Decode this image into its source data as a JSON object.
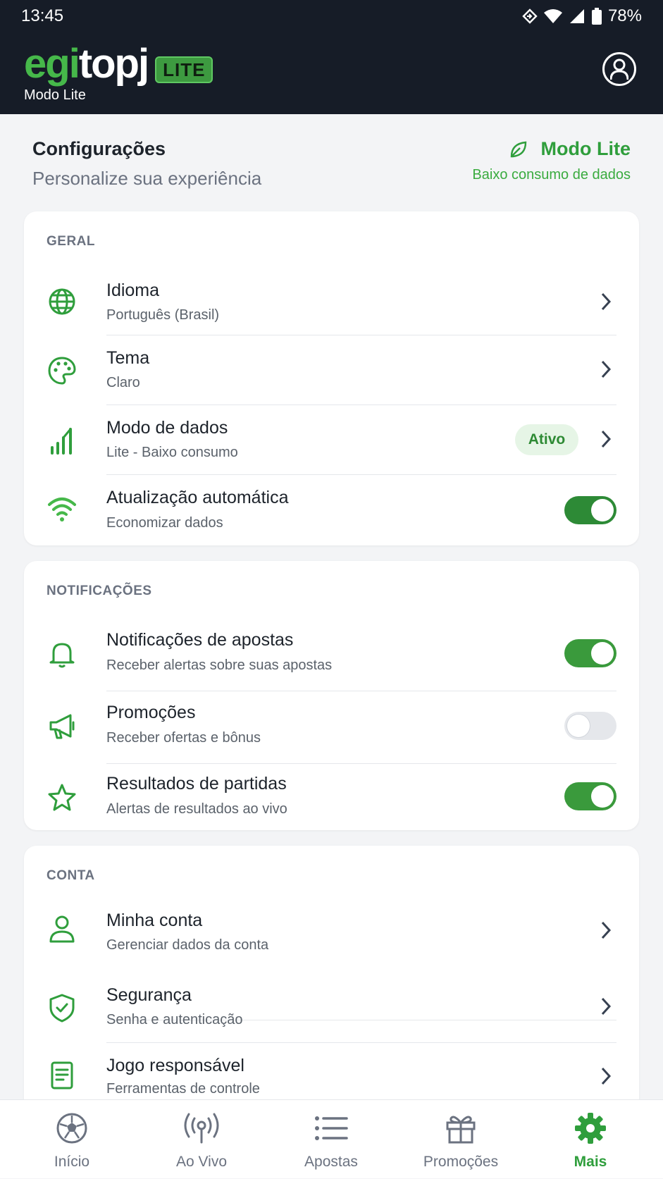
{
  "status": {
    "time": "13:45",
    "battery": "78%"
  },
  "header": {
    "logo_green1": "e",
    "logo_green2": "gi",
    "logo_white": "topj",
    "logo_badge": "LITE",
    "subtitle": "Modo Lite"
  },
  "page": {
    "title": "Configurações",
    "subtitle": "Personalize sua experiência",
    "lite_title": "Modo Lite",
    "lite_sub": "Baixo consumo de dados"
  },
  "general": {
    "title": "GERAL",
    "language": {
      "label": "Idioma",
      "value": "Português (Brasil)"
    },
    "theme": {
      "label": "Tema",
      "value": "Claro"
    },
    "data_mode": {
      "label": "Modo de dados",
      "value": "Lite - Baixo consumo",
      "badge": "Ativo"
    },
    "auto_update": {
      "label": "Atualização automática",
      "value": "Economizar dados",
      "enabled": true
    }
  },
  "notifications": {
    "title": "NOTIFICAÇÕES",
    "bets": {
      "label": "Notificações de apostas",
      "value": "Receber alertas sobre suas apostas",
      "enabled": true
    },
    "promos": {
      "label": "Promoções",
      "value": "Receber ofertas e bônus",
      "enabled": false
    },
    "results": {
      "label": "Resultados de partidas",
      "value": "Alertas de resultados ao vivo",
      "enabled": true
    }
  },
  "account": {
    "title": "CONTA",
    "my_account": {
      "label": "Minha conta",
      "value": "Gerenciar dados da conta"
    },
    "security": {
      "label": "Segurança",
      "value": "Senha e autenticação"
    },
    "responsible": {
      "label": "Jogo responsável",
      "value": "Ferramentas de controle"
    }
  },
  "nav": {
    "home": "Início",
    "live": "Ao Vivo",
    "bets": "Apostas",
    "promos": "Promoções",
    "more": "Mais",
    "active": "more"
  },
  "colors": {
    "accent": "#2f9e3c",
    "header_bg": "#161c27",
    "toggle_on": "#3a9a3c"
  }
}
